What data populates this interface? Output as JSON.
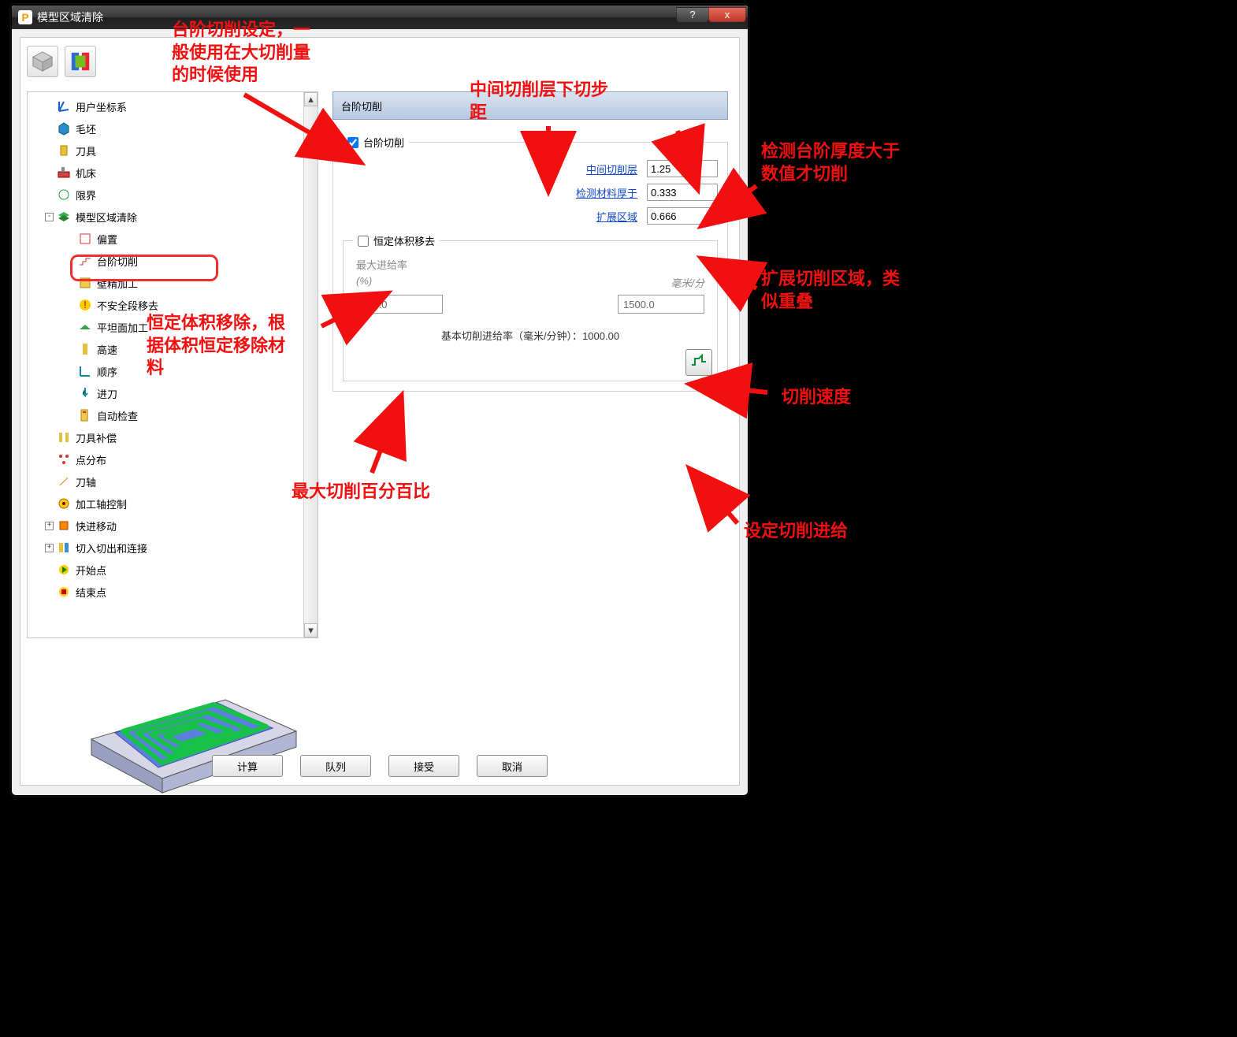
{
  "window": {
    "title": "模型区域清除",
    "help": "?",
    "close": "x"
  },
  "tree": {
    "items": [
      {
        "label": "用户坐标系",
        "icon": "axis"
      },
      {
        "label": "毛坯",
        "icon": "box-blue"
      },
      {
        "label": "刀具",
        "icon": "cyl"
      },
      {
        "label": "机床",
        "icon": "machine"
      },
      {
        "label": "限界",
        "icon": "limit"
      },
      {
        "label": "模型区域清除",
        "icon": "layers",
        "expand": "-"
      },
      {
        "label": "偏置",
        "icon": "offset",
        "child": true
      },
      {
        "label": "台阶切削",
        "icon": "step",
        "child": true,
        "selected": true
      },
      {
        "label": "壁精加工",
        "icon": "wall",
        "child": true
      },
      {
        "label": "不安全段移去",
        "icon": "unsafe",
        "child": true
      },
      {
        "label": "平坦面加工",
        "icon": "flat",
        "child": true
      },
      {
        "label": "高速",
        "icon": "speed",
        "child": true
      },
      {
        "label": "顺序",
        "icon": "order",
        "child": true
      },
      {
        "label": "进刀",
        "icon": "leadin",
        "child": true
      },
      {
        "label": "自动检查",
        "icon": "check",
        "child": true
      },
      {
        "label": "刀具补偿",
        "icon": "comp"
      },
      {
        "label": "点分布",
        "icon": "points"
      },
      {
        "label": "刀轴",
        "icon": "taxis"
      },
      {
        "label": "加工轴控制",
        "icon": "ctrl"
      },
      {
        "label": "快进移动",
        "icon": "rapid",
        "expand": "+"
      },
      {
        "label": "切入切出和连接",
        "icon": "link",
        "expand": "+"
      },
      {
        "label": "开始点",
        "icon": "start"
      },
      {
        "label": "结束点",
        "icon": "end"
      }
    ]
  },
  "section_title": "台阶切削",
  "step_group": {
    "checkbox_label": "台阶切削",
    "checked": true,
    "rows": [
      {
        "label": "中间切削层",
        "value": "1.25"
      },
      {
        "label": "检测材料厚于",
        "value": "0.333"
      },
      {
        "label": "扩展区域",
        "value": "0.666"
      }
    ]
  },
  "const_vol": {
    "checkbox_label": "恒定体积移去",
    "checked": false,
    "header": "最大进给率",
    "unit_pct": "(%)",
    "unit_mm": "毫米/分",
    "val_pct": "150.0",
    "val_mm": "1500.0",
    "base_label_prefix": "基本切削进给率（毫米/分钟）：",
    "base_value": "1000.00"
  },
  "buttons": {
    "calc": "计算",
    "queue": "队列",
    "accept": "接受",
    "cancel": "取消"
  },
  "annotations": {
    "a1": "台阶切削设定，一\n般使用在大切削量\n的时候使用",
    "a2": "中间切削层下切步\n距",
    "a3": "检测台阶厚度大于\n数值才切削",
    "a4": "扩展切削区域，类\n似重叠",
    "a5": "恒定体积移除，根\n据体积恒定移除材\n料",
    "a6": "最大切削百分百比",
    "a7": "切削速度",
    "a8": "设定切削进给"
  }
}
